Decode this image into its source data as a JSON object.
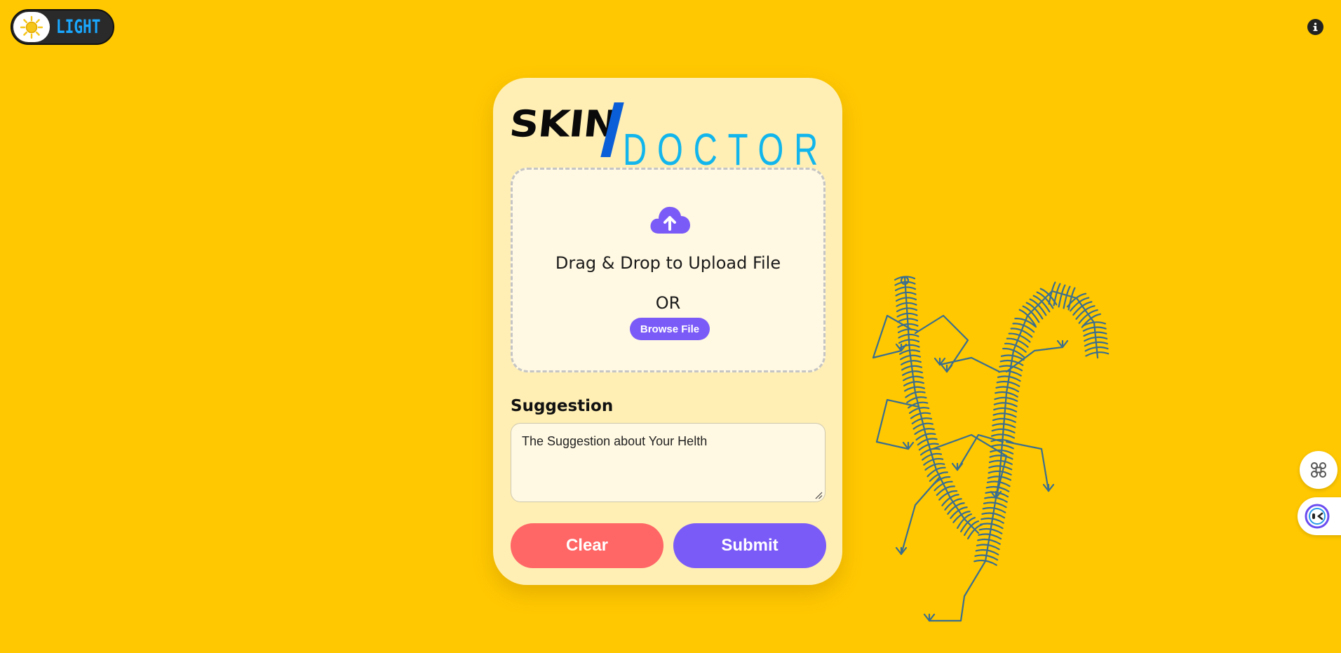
{
  "theme_toggle": {
    "label": "LIGHT",
    "icon": "sun-icon"
  },
  "info": {
    "icon": "info-icon"
  },
  "logo": {
    "part1": "SKIN",
    "part2": "DOCTOR"
  },
  "upload": {
    "icon": "cloud-upload-icon",
    "title": "Drag & Drop to Upload File",
    "or_text": "OR",
    "browse_label": "Browse File"
  },
  "suggestion": {
    "heading": "Suggestion",
    "value": "The Suggestion about Your Helth"
  },
  "actions": {
    "clear_label": "Clear",
    "submit_label": "Submit"
  },
  "side_widgets": [
    {
      "icon": "command-icon"
    },
    {
      "icon": "assistant-bot-icon"
    }
  ],
  "colors": {
    "background": "#FFC800",
    "card": "#FFEFB4",
    "accent_purple": "#7B5BF7",
    "clear_red": "#FF6666",
    "logo_blue": "#12B6EC",
    "lizard": "#3A6E8F"
  }
}
